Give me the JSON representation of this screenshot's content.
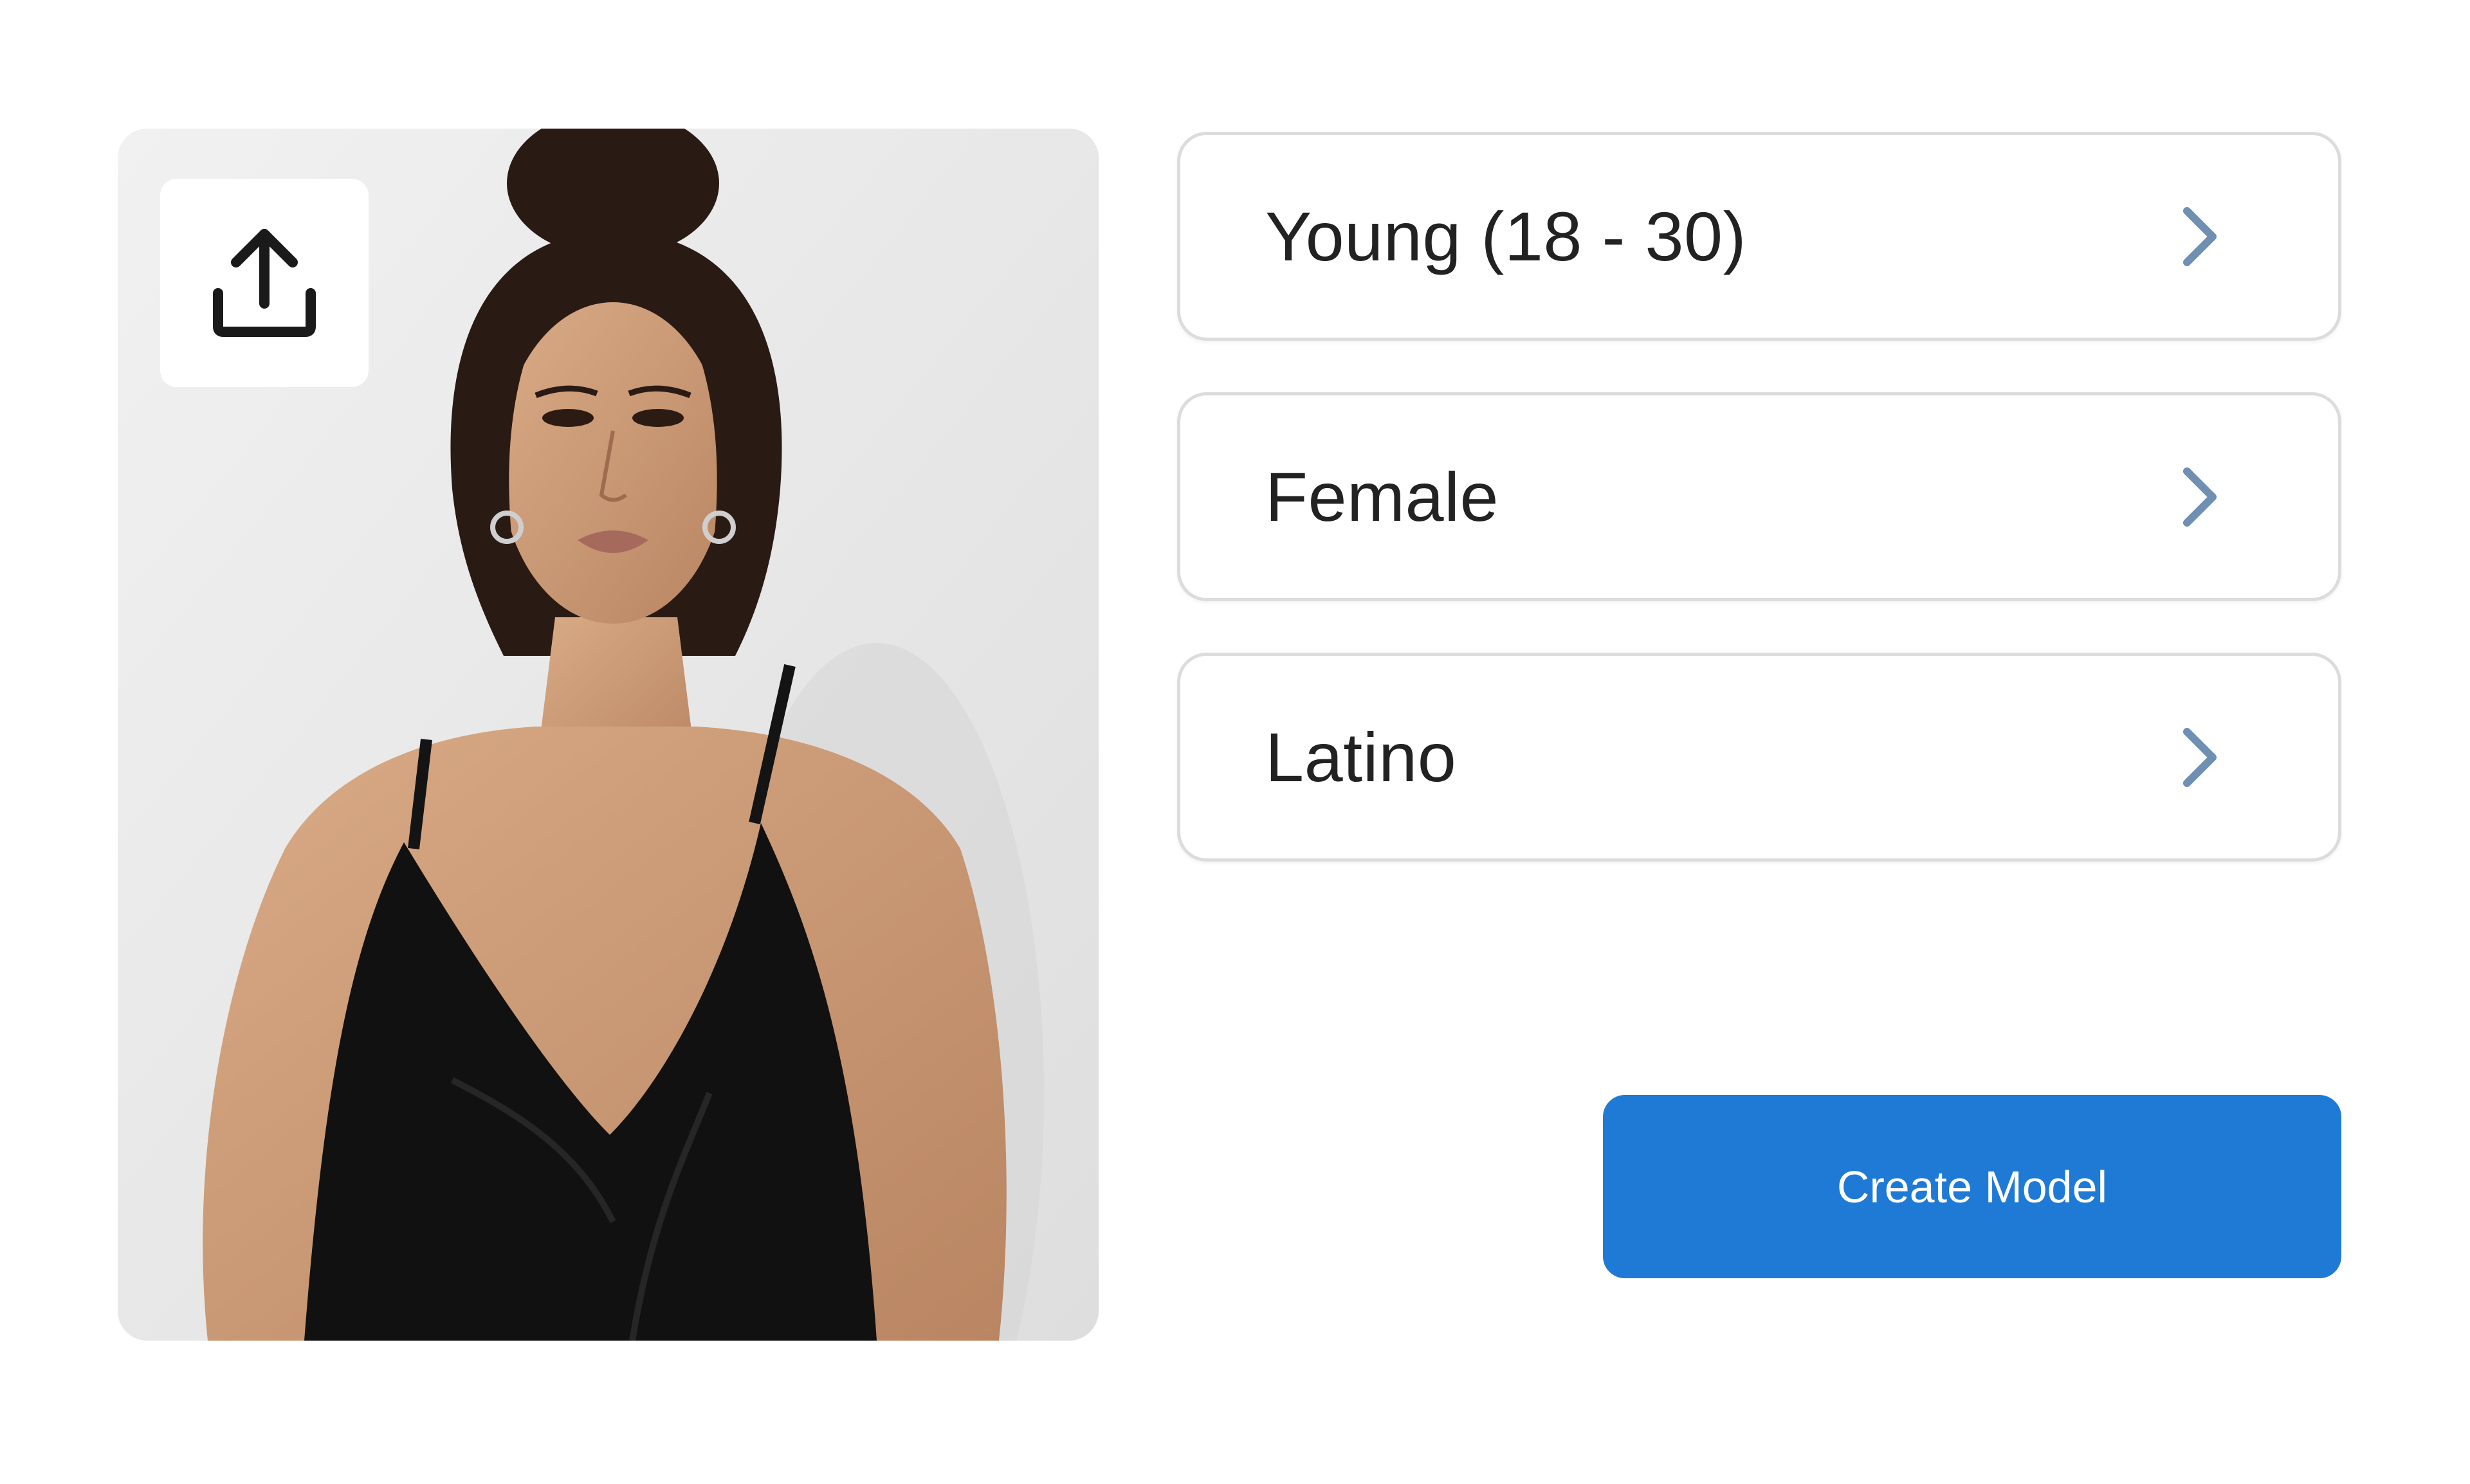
{
  "photo": {
    "upload_icon": "upload-icon"
  },
  "options": [
    {
      "label": "Young (18 - 30)",
      "icon": "chevron-right-icon"
    },
    {
      "label": "Female",
      "icon": "chevron-right-icon"
    },
    {
      "label": "Latino",
      "icon": "chevron-right-icon"
    }
  ],
  "actions": {
    "create_label": "Create Model"
  },
  "colors": {
    "accent": "#1f7ad6",
    "chevron": "#6f8fb3",
    "border": "#dcdcdc",
    "text": "#222222"
  }
}
